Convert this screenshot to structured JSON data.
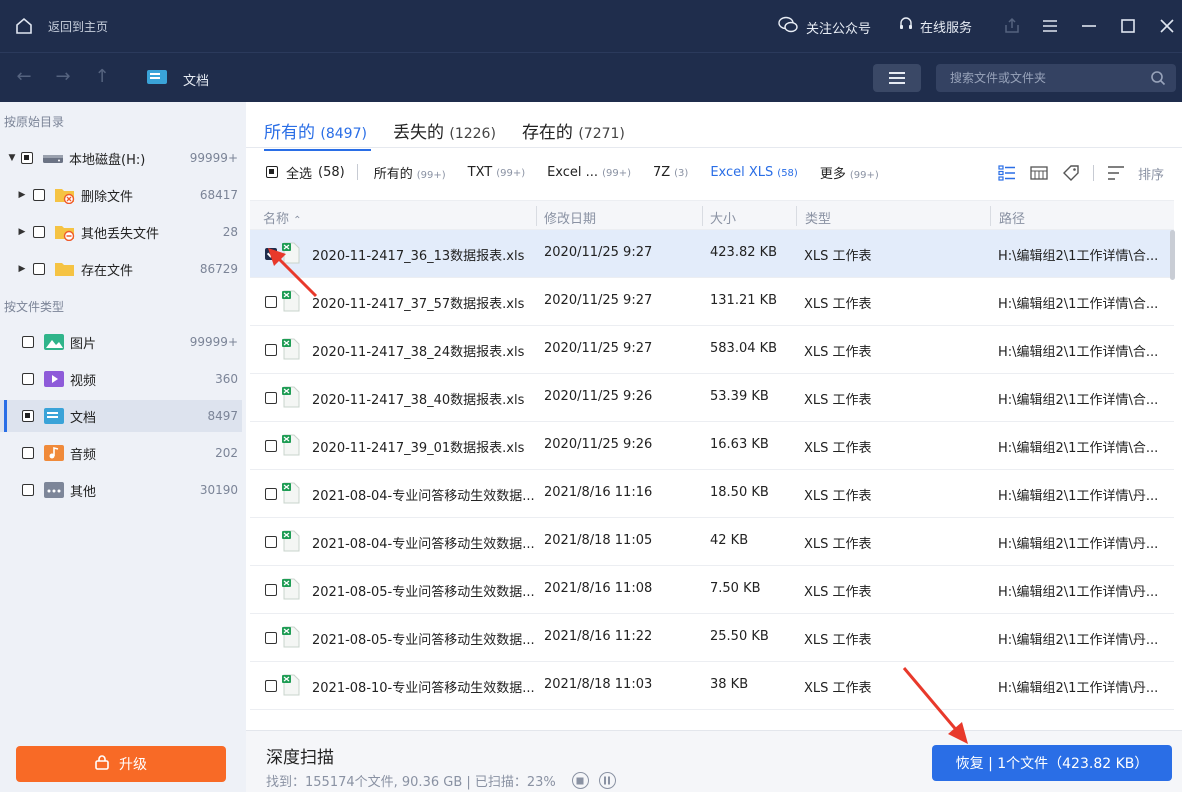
{
  "titlebar": {
    "back_home": "返回到主页",
    "wechat": "关注公众号",
    "service": "在线服务"
  },
  "navbar": {
    "crumb": "文档",
    "search_placeholder": "搜索文件或文件夹"
  },
  "sidebar": {
    "section_original": "按原始目录",
    "section_type": "按文件类型",
    "tree": [
      {
        "label": "本地磁盘(H:)",
        "count": "99999+"
      },
      {
        "label": "删除文件",
        "count": "68417"
      },
      {
        "label": "其他丢失文件",
        "count": "28"
      },
      {
        "label": "存在文件",
        "count": "86729"
      }
    ],
    "types": [
      {
        "label": "图片",
        "count": "99999+"
      },
      {
        "label": "视频",
        "count": "360"
      },
      {
        "label": "文档",
        "count": "8497"
      },
      {
        "label": "音频",
        "count": "202"
      },
      {
        "label": "其他",
        "count": "30190"
      }
    ],
    "upgrade": "升级"
  },
  "tabs": [
    {
      "label": "所有的",
      "count": "(8497)"
    },
    {
      "label": "丢失的",
      "count": "(1226)"
    },
    {
      "label": "存在的",
      "count": "(7271)"
    }
  ],
  "filters": {
    "select_all": "全选",
    "select_all_count": "(58)",
    "items": [
      {
        "label": "所有的",
        "count": "(99+)"
      },
      {
        "label": "TXT",
        "count": "(99+)"
      },
      {
        "label": "Excel ...",
        "count": "(99+)"
      },
      {
        "label": "7Z",
        "count": "(3)"
      },
      {
        "label": "Excel XLS",
        "count": "(58)"
      },
      {
        "label": "更多",
        "count": "(99+)"
      }
    ],
    "sort": "排序"
  },
  "columns": {
    "name": "名称",
    "modified": "修改日期",
    "size": "大小",
    "type": "类型",
    "path": "路径"
  },
  "rows": [
    {
      "name": "2020-11-2417_36_13数据报表.xls",
      "date": "2020/11/25 9:27",
      "size": "423.82 KB",
      "type": "XLS 工作表",
      "path": "H:\\编辑组2\\1工作详情\\合...",
      "checked": true
    },
    {
      "name": "2020-11-2417_37_57数据报表.xls",
      "date": "2020/11/25 9:27",
      "size": "131.21 KB",
      "type": "XLS 工作表",
      "path": "H:\\编辑组2\\1工作详情\\合...",
      "checked": false
    },
    {
      "name": "2020-11-2417_38_24数据报表.xls",
      "date": "2020/11/25 9:27",
      "size": "583.04 KB",
      "type": "XLS 工作表",
      "path": "H:\\编辑组2\\1工作详情\\合...",
      "checked": false
    },
    {
      "name": "2020-11-2417_38_40数据报表.xls",
      "date": "2020/11/25 9:26",
      "size": "53.39 KB",
      "type": "XLS 工作表",
      "path": "H:\\编辑组2\\1工作详情\\合...",
      "checked": false
    },
    {
      "name": "2020-11-2417_39_01数据报表.xls",
      "date": "2020/11/25 9:26",
      "size": "16.63 KB",
      "type": "XLS 工作表",
      "path": "H:\\编辑组2\\1工作详情\\合...",
      "checked": false
    },
    {
      "name": "2021-08-04-专业问答移动生效数据...",
      "date": "2021/8/16 11:16",
      "size": "18.50 KB",
      "type": "XLS 工作表",
      "path": "H:\\编辑组2\\1工作详情\\丹...",
      "checked": false
    },
    {
      "name": "2021-08-04-专业问答移动生效数据...",
      "date": "2021/8/18 11:05",
      "size": "42 KB",
      "type": "XLS 工作表",
      "path": "H:\\编辑组2\\1工作详情\\丹...",
      "checked": false
    },
    {
      "name": "2021-08-05-专业问答移动生效数据...",
      "date": "2021/8/16 11:08",
      "size": "7.50 KB",
      "type": "XLS 工作表",
      "path": "H:\\编辑组2\\1工作详情\\丹...",
      "checked": false
    },
    {
      "name": "2021-08-05-专业问答移动生效数据...",
      "date": "2021/8/16 11:22",
      "size": "25.50 KB",
      "type": "XLS 工作表",
      "path": "H:\\编辑组2\\1工作详情\\丹...",
      "checked": false
    },
    {
      "name": "2021-08-10-专业问答移动生效数据...",
      "date": "2021/8/18 11:03",
      "size": "38 KB",
      "type": "XLS 工作表",
      "path": "H:\\编辑组2\\1工作详情\\丹...",
      "checked": false
    }
  ],
  "footer": {
    "title": "深度扫描",
    "status": "找到：155174个文件, 90.36 GB | 已扫描：23%",
    "recover": "恢复 | 1个文件（423.82 KB）"
  },
  "colors": {
    "titlebar_bg": "#1f2d4c",
    "accent": "#2a6ee6",
    "upgrade": "#f86a26",
    "annotation": "#e8392b"
  }
}
